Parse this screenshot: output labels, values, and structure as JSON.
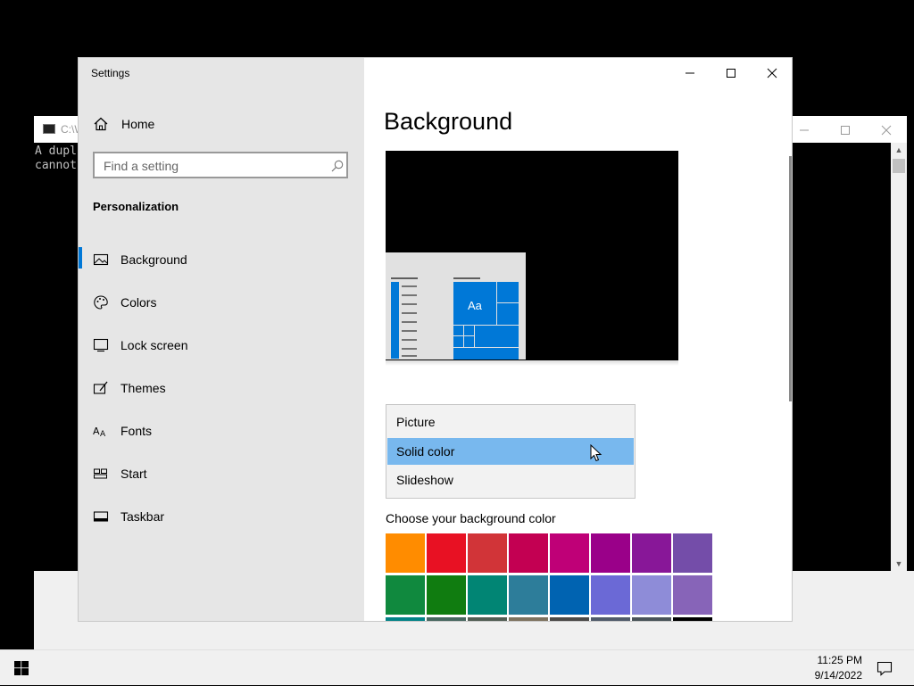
{
  "console": {
    "title": "C:\\W",
    "lines": [
      "A dupl",
      "cannot"
    ],
    "minimize_icon": "minimize-icon",
    "maximize_icon": "maximize-icon",
    "close_icon": "close-icon"
  },
  "settings": {
    "window_title": "Settings",
    "home_label": "Home",
    "search_placeholder": "Find a setting",
    "section_title": "Personalization",
    "nav_items": [
      {
        "label": "Background",
        "icon": "picture-icon",
        "selected": true
      },
      {
        "label": "Colors",
        "icon": "palette-icon",
        "selected": false
      },
      {
        "label": "Lock screen",
        "icon": "lock-screen-icon",
        "selected": false
      },
      {
        "label": "Themes",
        "icon": "themes-icon",
        "selected": false
      },
      {
        "label": "Fonts",
        "icon": "fonts-icon",
        "selected": false
      },
      {
        "label": "Start",
        "icon": "start-icon",
        "selected": false
      },
      {
        "label": "Taskbar",
        "icon": "taskbar-icon",
        "selected": false
      }
    ],
    "accent_color": "#0078d7"
  },
  "main": {
    "page_title": "Background",
    "preview_tile_text": "Aa",
    "background_options": [
      "Picture",
      "Solid color",
      "Slideshow"
    ],
    "selected_option": "Solid color",
    "color_label": "Choose your background color",
    "swatch_rows": [
      [
        "#ff8c00",
        "#e81123",
        "#d13438",
        "#c30052",
        "#bf0077",
        "#9a0089",
        "#881798",
        "#744da9"
      ],
      [
        "#10893e",
        "#107c10",
        "#018574",
        "#2d7d9a",
        "#0063b1",
        "#6b69d6",
        "#8e8cd8",
        "#8764b8"
      ],
      [
        "#038387",
        "#486860",
        "#525e54",
        "#7e735f",
        "#4c4a48",
        "#515c6b",
        "#4a5459",
        "#000000"
      ]
    ]
  },
  "taskbar": {
    "time": "11:25 PM",
    "date": "9/14/2022"
  }
}
